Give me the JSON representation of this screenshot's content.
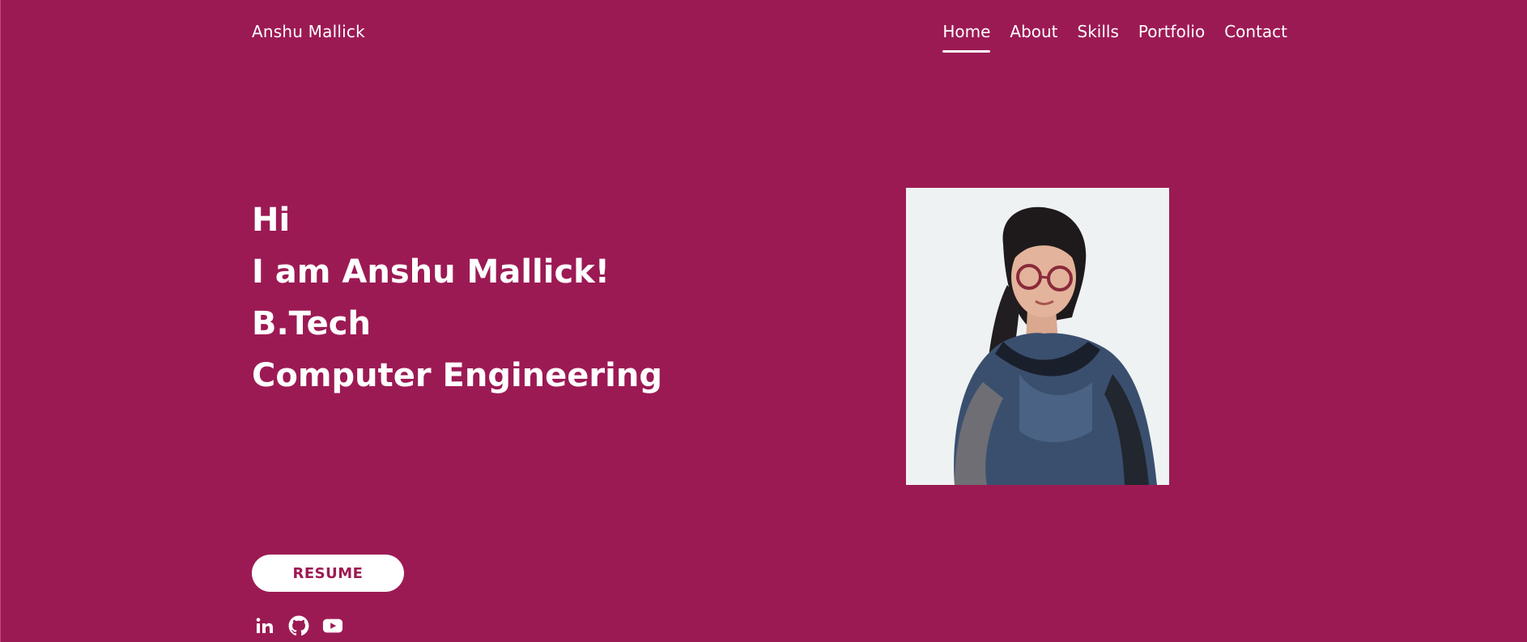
{
  "header": {
    "brand": "Anshu Mallick",
    "nav": [
      {
        "label": "Home",
        "active": true
      },
      {
        "label": "About",
        "active": false
      },
      {
        "label": "Skills",
        "active": false
      },
      {
        "label": "Portfolio",
        "active": false
      },
      {
        "label": "Contact",
        "active": false
      }
    ]
  },
  "hero": {
    "lines": [
      "Hi",
      "I am Anshu Mallick!",
      "B.Tech",
      "Computer Engineering"
    ]
  },
  "resume": {
    "label": "RESUME"
  },
  "socials": [
    {
      "icon": "linkedin-icon"
    },
    {
      "icon": "github-icon"
    },
    {
      "icon": "youtube-icon"
    }
  ],
  "colors": {
    "background": "#9c1a54",
    "text": "#ffffff",
    "button_bg": "#ffffff",
    "button_text": "#9c1a54"
  }
}
